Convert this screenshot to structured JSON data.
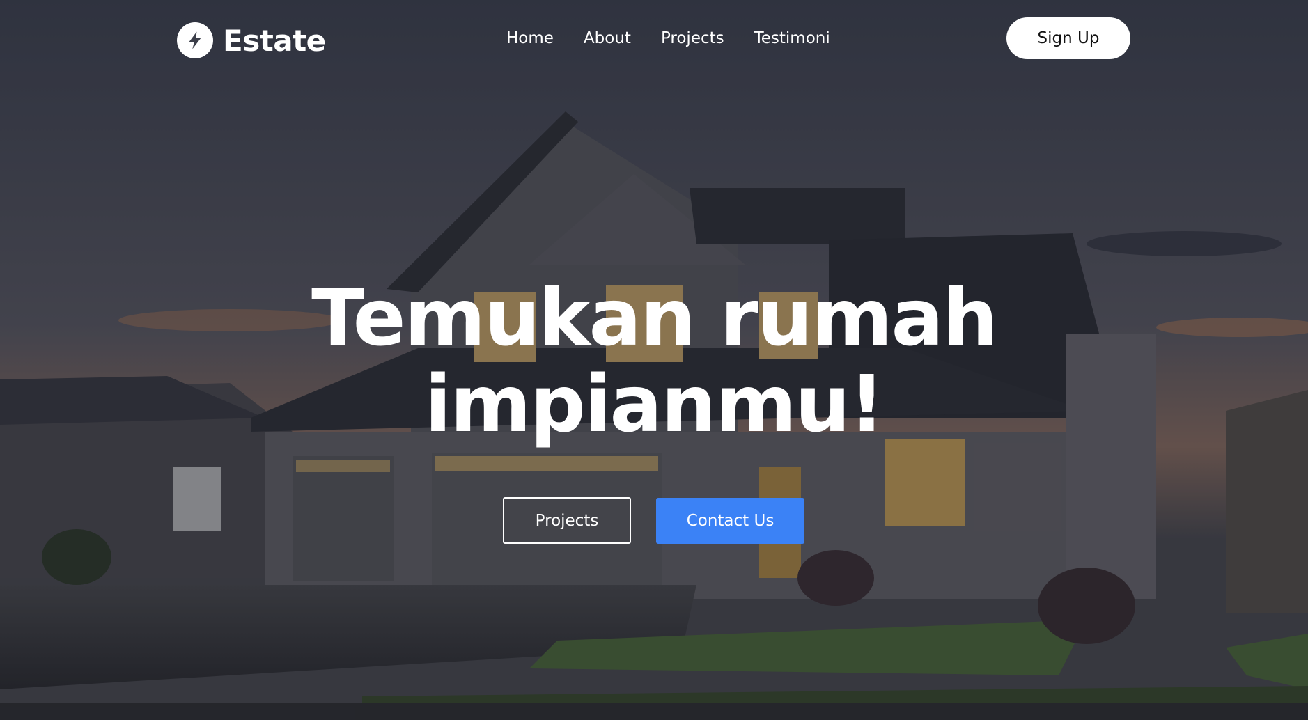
{
  "brand": {
    "name": "Estate",
    "logo_icon": "lightning-bolt-icon"
  },
  "nav": {
    "items": [
      {
        "label": "Home"
      },
      {
        "label": "About"
      },
      {
        "label": "Projects"
      },
      {
        "label": "Testimoni"
      }
    ],
    "signup_label": "Sign Up"
  },
  "hero": {
    "headline_line1": "Temukan rumah",
    "headline_line2": "impianmu!",
    "primary_button": "Contact Us",
    "secondary_button": "Projects",
    "background": "house-at-dusk-photo"
  },
  "colors": {
    "accent": "#3b82f6",
    "text": "#ffffff"
  }
}
